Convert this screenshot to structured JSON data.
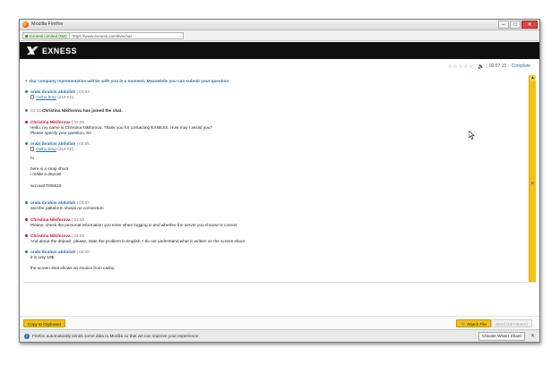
{
  "browser": {
    "title": "Mozilla Firefox",
    "site_identity": "Exness Limited (NZ)",
    "url": "https://www.exness.com/livechat",
    "window_buttons": [
      "–",
      "□",
      "✕"
    ]
  },
  "header": {
    "logo_text": "EXNESS",
    "accent_color": "#f3c20e"
  },
  "toolbar": {
    "rating_stars": [
      "☆",
      "☆",
      "☆",
      "☆",
      "☆"
    ],
    "speaker_icon": "🔈",
    "separator": "|",
    "timer": "00:07:15",
    "complete_label": "Complete"
  },
  "chat": {
    "system_notice": "Our company representative will be with you in a moment. Meanwhile you can submit your question.",
    "messages": [
      {
        "author": "orabi ibrahim abdullah",
        "time": "03:54",
        "file": "cashu.bmp",
        "size": "(218 Kb)"
      },
      {
        "time": "03:54",
        "event": "Christina Nikiforova has joined the chat."
      },
      {
        "author": "Christina Nikiforova",
        "time": "03:55",
        "lines": [
          "Hello, my name is Christina Nikiforova. Thank you for contacting EXNESS. How may I assist you?",
          "Please specify your question, Sir"
        ]
      },
      {
        "author": "orabi ibrahim abdullah",
        "time": "03:55",
        "file": "cashu.bmp",
        "size": "(218 Kb)",
        "lines": [
          "hi",
          "here is a snap shoot",
          "i made a deposit",
          "account7006619"
        ]
      },
      {
        "author": "orabi ibrahim abdullah",
        "time": "03:57",
        "lines": [
          "and the paltaform shows no connection"
        ]
      },
      {
        "author": "Christina Nikiforova",
        "time": "03:58",
        "lines": [
          "Please, check the personal information you enter when logging in and whether the server you choose is correct"
        ]
      },
      {
        "author": "Christina Nikiforova",
        "time": "04:00",
        "lines": [
          "And about the deposit, please, state the problem in English, I do not understand what is written on the screen shoot"
        ]
      },
      {
        "author": "orabi ibrahim abdullah",
        "time": "04:00",
        "lines": [
          "it is only 10$",
          "the screen shot shows an invoice from cashu"
        ]
      }
    ]
  },
  "actions": {
    "copy_label": "Copy to Clipboard",
    "attach_label": "Attach File",
    "send_label": "Send (Ctrl+Enter)"
  },
  "notification": {
    "info_icon": "i",
    "text": "Firefox automatically sends some data to Mozilla so that we can improve your experience.",
    "button_label": "Choose What I Share",
    "close": "✕"
  },
  "scrollbar": {
    "up": "▲",
    "down": "▼",
    "grip": "≡"
  },
  "chat_icons": {
    "notice": "▾"
  }
}
